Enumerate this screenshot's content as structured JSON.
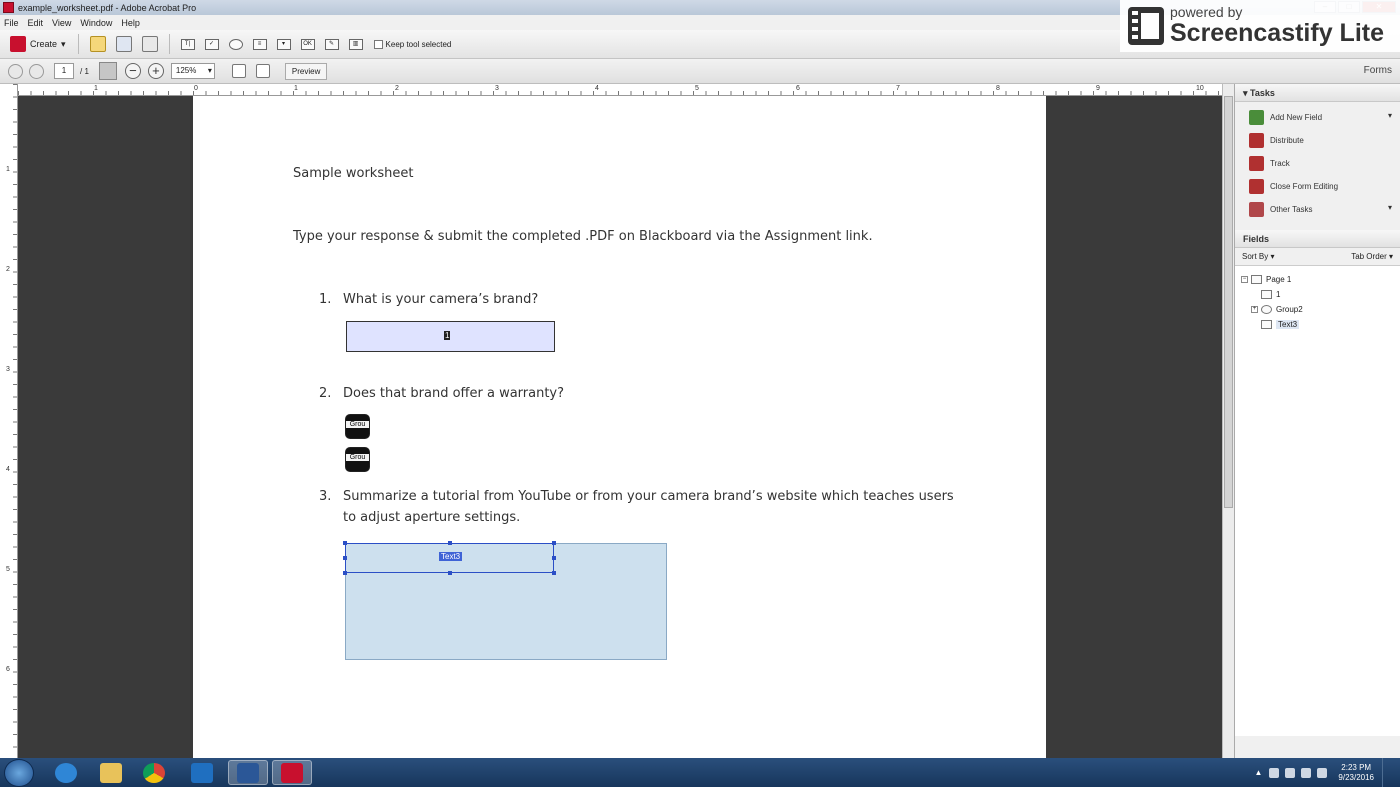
{
  "window": {
    "title": "example_worksheet.pdf - Adobe Acrobat Pro"
  },
  "menu": [
    "File",
    "Edit",
    "View",
    "Window",
    "Help"
  ],
  "toolbar": {
    "create_label": "Create",
    "keep_tool_label": "Keep tool selected"
  },
  "watermark": {
    "small": "powered by",
    "big": "Screencastify Lite"
  },
  "nav": {
    "page_current": "1",
    "page_total": "/ 1",
    "zoom": "125%",
    "preview_label": "Preview",
    "mode_label": "Forms"
  },
  "ruler": {
    "top_labels": [
      "1",
      "0",
      "1",
      "2",
      "3",
      "4",
      "5",
      "6",
      "7",
      "8",
      "9",
      "10"
    ],
    "left_labels": [
      "1",
      "2",
      "3",
      "4",
      "5",
      "6"
    ]
  },
  "document": {
    "heading": "Sample worksheet",
    "instructions": "Type your response & submit the completed .PDF on Blackboard via the Assignment link.",
    "q1_num": "1.",
    "q1_text": "What is your camera’s brand?",
    "q1_field_name": "1",
    "q2_num": "2.",
    "q2_text": "Does that brand offer a warranty?",
    "radio_label": "Grou",
    "q3_num": "3.",
    "q3_line1": "Summarize a tutorial from YouTube or from your camera brand’s website which teaches users",
    "q3_line2": "to adjust aperture settings.",
    "q3_field_name": "Text3"
  },
  "panel": {
    "tasks_title": "Tasks",
    "tasks": [
      {
        "label": "Add New Field",
        "icon": "add-field-icon",
        "color": "#4a8d3a",
        "has_menu": true
      },
      {
        "label": "Distribute",
        "icon": "distribute-icon",
        "color": "#b03030",
        "has_menu": false
      },
      {
        "label": "Track",
        "icon": "track-icon",
        "color": "#b03030",
        "has_menu": false
      },
      {
        "label": "Close Form Editing",
        "icon": "close-form-icon",
        "color": "#b03030",
        "has_menu": false
      },
      {
        "label": "Other Tasks",
        "icon": "other-tasks-icon",
        "color": "#b0474a",
        "has_menu": true
      }
    ],
    "fields_title": "Fields",
    "sort_by": "Sort By ▾",
    "tab_order": "Tab Order ▾",
    "tree": {
      "page": "Page 1",
      "field1": "1",
      "group": "Group2",
      "text3": "Text3"
    }
  },
  "taskbar": {
    "time": "2:23 PM",
    "date": "9/23/2016"
  }
}
